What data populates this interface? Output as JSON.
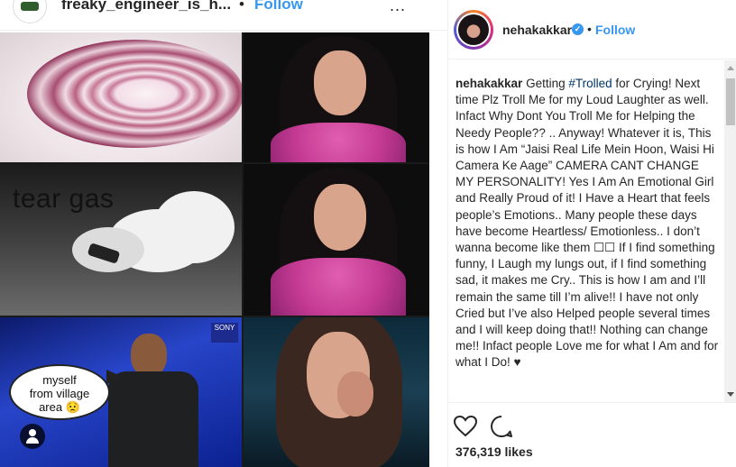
{
  "background_post": {
    "username": "freaky_engineer_is_h...",
    "separator": "•",
    "follow_label": "Follow",
    "more_label": "..."
  },
  "meme": {
    "tear_gas_text": "tear gas",
    "speech_bubble_line1": "myself",
    "speech_bubble_line2": "from village",
    "speech_bubble_line3": "area 😟",
    "channel_logo": "SONY"
  },
  "post": {
    "username": "nehakakkar",
    "verified_glyph": "✓",
    "separator": "•",
    "follow_label": "Follow",
    "caption_user": "nehakakkar",
    "caption_pre": " Getting ",
    "caption_hashtag": "#Trolled",
    "caption_body": " for Crying! Next time Plz Troll Me for my Loud Laughter as well. Infact Why Dont You Troll Me for Helping the Needy People?? .. Anyway! Whatever it is, This is how I Am “Jaisi Real Life Mein Hoon, Waisi Hi Camera Ke Aage” CAMERA CANT CHANGE MY PERSONALITY! Yes I Am An Emotional Girl and Really Proud of it! I Have a Heart that feels people’s Emotions.. Many people these days have become Heartless/ Emotionless.. I don’t wanna become like them ☐☐ If I find something funny, I Laugh my lungs out, if I find something sad, it makes me Cry.. This is how I am and I’ll remain the same till I’m alive!! I have not only Cried but I’ve also Helped people several times and I will keep doing that!! Nothing can change me!! Infact people Love me for what I Am and for what I Do! ♥",
    "likes": "376,319 likes"
  },
  "icons": {
    "like": "heart-icon",
    "comment": "comment-icon",
    "verified": "verified-badge-icon",
    "tag": "user-tag-icon"
  },
  "colors": {
    "link_blue": "#3897f0",
    "text": "#262626",
    "hashtag": "#003569",
    "border": "#efefef"
  }
}
